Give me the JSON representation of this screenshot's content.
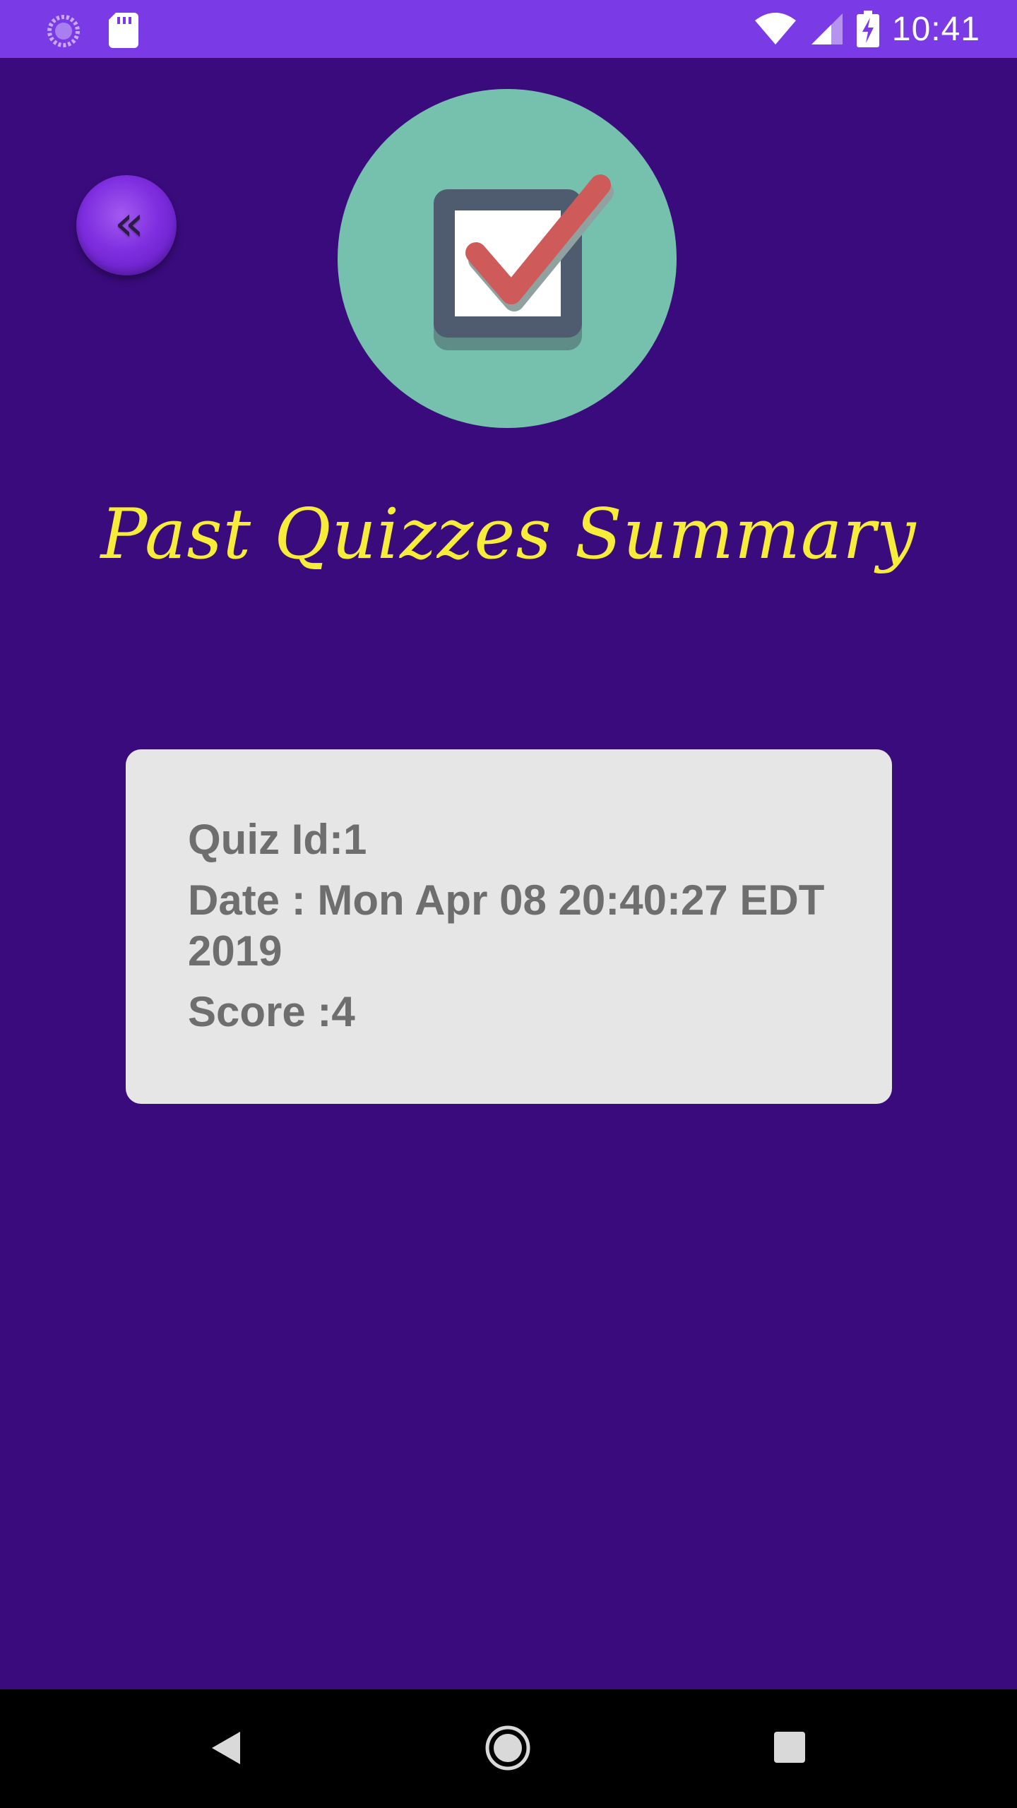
{
  "status_bar": {
    "time": "10:41",
    "icons": [
      "loading-indicator-icon",
      "sd-card-icon",
      "wifi-icon",
      "cell-signal-icon",
      "battery-charging-icon"
    ],
    "color": "#7a3ae5"
  },
  "header": {
    "back_button_glyph": "«",
    "logo_icon": "checkbox-checked-icon",
    "title": "Past Quizzes Summary",
    "title_color": "#f7ec3a"
  },
  "summary_card": {
    "quiz_id": "Quiz Id:1",
    "date": "Date : Mon Apr 08 20:40:27 EDT 2019",
    "score": "Score :4"
  },
  "nav_bar": {
    "icons": [
      "nav-back-icon",
      "nav-home-icon",
      "nav-recents-icon"
    ]
  },
  "colors": {
    "background": "#3a0b7d",
    "card": "#e6e6e6",
    "card_text": "#6e6e6e",
    "logo_circle": "#76c1ae"
  }
}
